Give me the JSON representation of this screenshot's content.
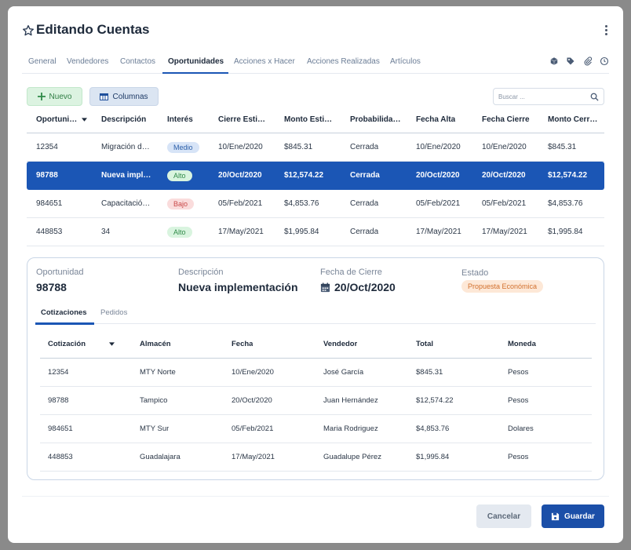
{
  "dialog": {
    "title": "Editando Cuentas"
  },
  "tabs": [
    {
      "label": "General"
    },
    {
      "label": "Vendedores"
    },
    {
      "label": "Contactos"
    },
    {
      "label": "Oportunidades",
      "active": true
    },
    {
      "label": "Acciones x Hacer"
    },
    {
      "label": "Acciones Realizadas"
    },
    {
      "label": "Artículos"
    }
  ],
  "tab_icons": [
    "cube-icon",
    "tag-icon",
    "paperclip-icon",
    "clock-icon"
  ],
  "toolbar": {
    "new_label": "Nuevo",
    "columns_label": "Columnas"
  },
  "search": {
    "placeholder": "Buscar ..."
  },
  "grid": {
    "headers": [
      "Oportuni…",
      "Descripción",
      "Interés",
      "Cierre Esti…",
      "Monto Esti…",
      "Probabilida…",
      "Fecha Alta",
      "Fecha Cierre",
      "Monto Cerr…"
    ],
    "rows": [
      {
        "id": "12354",
        "desc": "Migración d…",
        "interest": "Medio",
        "close_est": "10/Ene/2020",
        "amount_est": "$845.31",
        "prob": "Cerrada",
        "created": "10/Ene/2020",
        "closed": "10/Ene/2020",
        "amount_closed": "$845.31"
      },
      {
        "id": "98788",
        "desc": "Nueva impl…",
        "interest": "Alto",
        "close_est": "20/Oct/2020",
        "amount_est": "$12,574.22",
        "prob": "Cerrada",
        "created": "20/Oct/2020",
        "closed": "20/Oct/2020",
        "amount_closed": "$12,574.22"
      },
      {
        "id": "984651",
        "desc": "Capacitació…",
        "interest": "Bajo",
        "close_est": "05/Feb/2021",
        "amount_est": "$4,853.76",
        "prob": "Cerrada",
        "created": "05/Feb/2021",
        "closed": "05/Feb/2021",
        "amount_closed": "$4,853.76"
      },
      {
        "id": "448853",
        "desc": "34",
        "interest": "Alto",
        "close_est": "17/May/2021",
        "amount_est": "$1,995.84",
        "prob": "Cerrada",
        "created": "17/May/2021",
        "closed": "17/May/2021",
        "amount_closed": "$1,995.84"
      }
    ]
  },
  "detail": {
    "opportunity_label": "Oportunidad",
    "opportunity_value": "98788",
    "description_label": "Descripción",
    "description_value": "Nueva implementación",
    "close_date_label": "Fecha de Cierre",
    "close_date_value": "20/Oct/2020",
    "status_label": "Estado",
    "status_value": "Propuesta Económica",
    "subtabs": [
      "Cotizaciones",
      "Pedidos"
    ],
    "quotes": {
      "headers": [
        "Cotización",
        "Almacén",
        "Fecha",
        "Vendedor",
        "Total",
        "Moneda"
      ],
      "rows": [
        {
          "id": "12354",
          "warehouse": "MTY Norte",
          "date": "10/Ene/2020",
          "seller": "José García",
          "total": "$845.31",
          "currency": "Pesos"
        },
        {
          "id": "98788",
          "warehouse": "Tampico",
          "date": "20/Oct/2020",
          "seller": "Juan Hernández",
          "total": "$12,574.22",
          "currency": "Pesos"
        },
        {
          "id": "984651",
          "warehouse": "MTY Sur",
          "date": "05/Feb/2021",
          "seller": "Maria Rodriguez",
          "total": "$4,853.76",
          "currency": "Dolares"
        },
        {
          "id": "448853",
          "warehouse": "Guadalajara",
          "date": "17/May/2021",
          "seller": "Guadalupe Pérez",
          "total": "$1,995.84",
          "currency": "Pesos"
        }
      ]
    }
  },
  "footer": {
    "cancel_label": "Cancelar",
    "save_label": "Guardar"
  },
  "colors": {
    "accent": "#1b56b5",
    "selected_row": "#1b56b5",
    "save_button": "#1b4fa8"
  }
}
